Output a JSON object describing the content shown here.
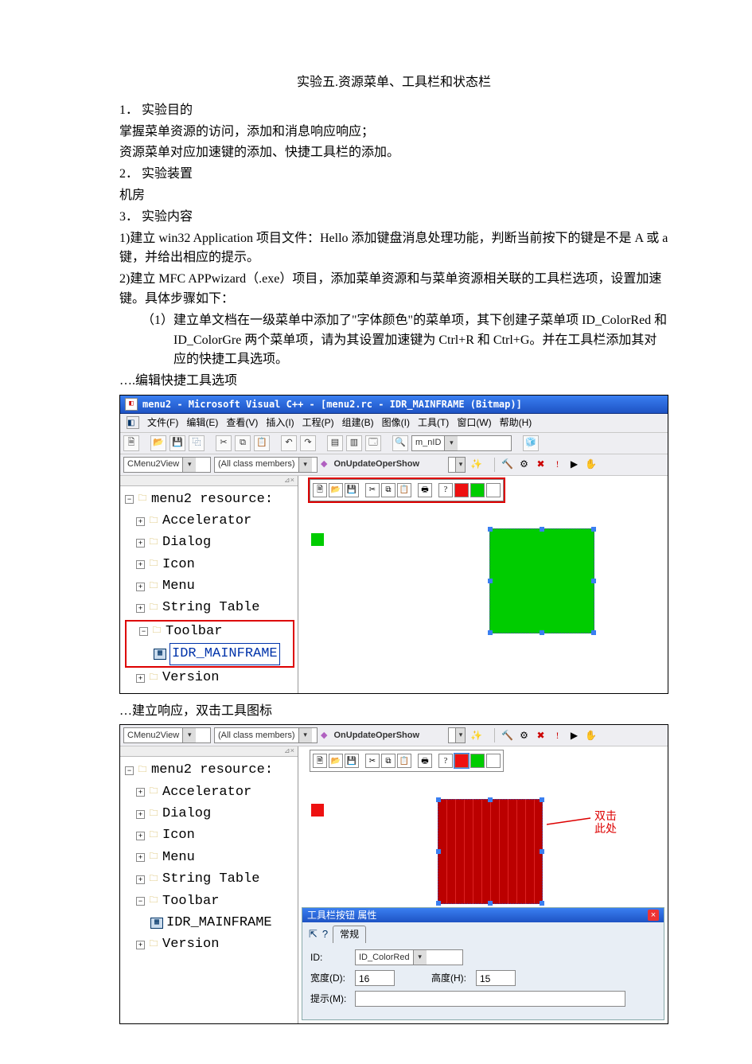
{
  "title": "实验五.资源菜单、工具栏和状态栏",
  "body": {
    "p1_h": "1． 实验目的",
    "p1_a": "掌握菜单资源的访问，添加和消息响应响应；",
    "p1_b": "资源菜单对应加速键的添加、快捷工具栏的添加。",
    "p2_h": "2． 实验装置",
    "p2_a": "机房",
    "p3_h": "3． 实验内容",
    "p3_a": "1)建立 win32  Application 项目文件：Hello 添加键盘消息处理功能，判断当前按下的键是不是 A 或 a 键，并给出相应的提示。",
    "p3_b": "2)建立 MFC APPwizard（.exe）项目，添加菜单资源和与菜单资源相关联的工具栏选项，设置加速键。具体步骤如下：",
    "step1_head": "（1）  建立单文档在一级菜单中添加了\"字体颜色\"的菜单项，其下创建子菜单项 ID_ColorRed 和 ID_ColorGre 两个菜单项，请为其设置加速键为 Ctrl+R 和 Ctrl+G。并在工具栏添加其对应的快捷工具选项。",
    "caption1": "….编辑快捷工具选项",
    "caption2": "…建立响应，双击工具图标"
  },
  "shot1": {
    "title": "menu2 - Microsoft Visual C++ - [menu2.rc - IDR_MAINFRAME (Bitmap)]",
    "menus": [
      "文件(F)",
      "编辑(E)",
      "查看(V)",
      "插入(I)",
      "工程(P)",
      "组建(B)",
      "图像(I)",
      "工具(T)",
      "窗口(W)",
      "帮助(H)"
    ],
    "combo1": "CMenu2View",
    "combo2": "(All class members)",
    "combo3": "OnUpdateOperShow",
    "find": "m_nID",
    "tree": {
      "root": "menu2 resource:",
      "items": [
        "Accelerator",
        "Dialog",
        "Icon",
        "Menu",
        "String Table",
        "Toolbar",
        "Version"
      ],
      "toolbar_child": "IDR_MAINFRAME"
    }
  },
  "shot2": {
    "combo1": "CMenu2View",
    "combo2": "(All class members)",
    "combo3": "OnUpdateOperShow",
    "tree": {
      "root": "menu2 resource:",
      "items": [
        "Accelerator",
        "Dialog",
        "Icon",
        "Menu",
        "String Table",
        "Toolbar",
        "Version"
      ],
      "toolbar_child": "IDR_MAINFRAME"
    },
    "annot1": "双击",
    "annot2": "此处",
    "props": {
      "title": "工具栏按钮 属性",
      "tab": "常规",
      "id_label": "ID:",
      "id_value": "ID_ColorRed",
      "w_label": "宽度(D):",
      "w_value": "16",
      "h_label": "高度(H):",
      "h_value": "15",
      "tip_label": "提示(M):",
      "tip_value": ""
    }
  }
}
